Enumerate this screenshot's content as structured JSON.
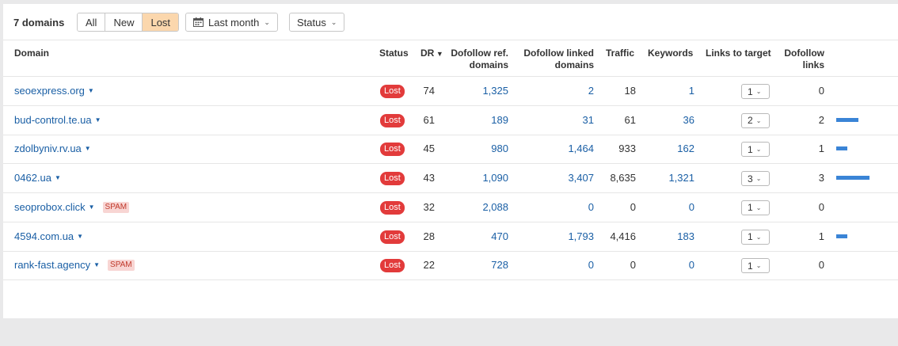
{
  "header": {
    "count_label": "7 domains",
    "filters": [
      "All",
      "New",
      "Lost"
    ],
    "active_filter": "Lost",
    "date_label": "Last month",
    "status_label": "Status"
  },
  "columns": {
    "domain": "Domain",
    "status": "Status",
    "dr": "DR",
    "dofollow_ref_1": "Dofollow ref.",
    "dofollow_ref_2": "domains",
    "dofollow_linked_1": "Dofollow linked",
    "dofollow_linked_2": "domains",
    "traffic": "Traffic",
    "keywords": "Keywords",
    "links_to_target": "Links to target",
    "dofollow_links_1": "Dofollow",
    "dofollow_links_2": "links"
  },
  "rows": [
    {
      "domain": "seoexpress.org",
      "spam": "",
      "status": "Lost",
      "dr": "74",
      "ref_domains": "1,325",
      "linked_domains": "2",
      "traffic": "18",
      "keywords": "1",
      "links": "1",
      "dofollow_links": "0",
      "bar_level": 0
    },
    {
      "domain": "bud-control.te.ua",
      "spam": "",
      "status": "Lost",
      "dr": "61",
      "ref_domains": "189",
      "linked_domains": "31",
      "traffic": "61",
      "keywords": "36",
      "links": "2",
      "dofollow_links": "2",
      "bar_level": 0.667
    },
    {
      "domain": "zdolbyniv.rv.ua",
      "spam": "",
      "status": "Lost",
      "dr": "45",
      "ref_domains": "980",
      "linked_domains": "1,464",
      "traffic": "933",
      "keywords": "162",
      "links": "1",
      "dofollow_links": "1",
      "bar_level": 0.333
    },
    {
      "domain": "0462.ua",
      "spam": "",
      "status": "Lost",
      "dr": "43",
      "ref_domains": "1,090",
      "linked_domains": "3,407",
      "traffic": "8,635",
      "keywords": "1,321",
      "links": "3",
      "dofollow_links": "3",
      "bar_level": 1
    },
    {
      "domain": "seoprobox.click",
      "spam": "SPAM",
      "status": "Lost",
      "dr": "32",
      "ref_domains": "2,088",
      "linked_domains": "0",
      "traffic": "0",
      "keywords": "0",
      "links": "1",
      "dofollow_links": "0",
      "bar_level": 0
    },
    {
      "domain": "4594.com.ua",
      "spam": "",
      "status": "Lost",
      "dr": "28",
      "ref_domains": "470",
      "linked_domains": "1,793",
      "traffic": "4,416",
      "keywords": "183",
      "links": "1",
      "dofollow_links": "1",
      "bar_level": 0.333
    },
    {
      "domain": "rank-fast.agency",
      "spam": "SPAM",
      "status": "Lost",
      "dr": "22",
      "ref_domains": "728",
      "linked_domains": "0",
      "traffic": "0",
      "keywords": "0",
      "links": "1",
      "dofollow_links": "0",
      "bar_level": 0
    }
  ],
  "colors": {
    "accent_link": "#1a5fa5",
    "lost_badge": "#e23b3b",
    "active_filter_bg": "#fbd7ad",
    "bar": "#3a84d6",
    "spam_bg": "#f8d5d3"
  }
}
